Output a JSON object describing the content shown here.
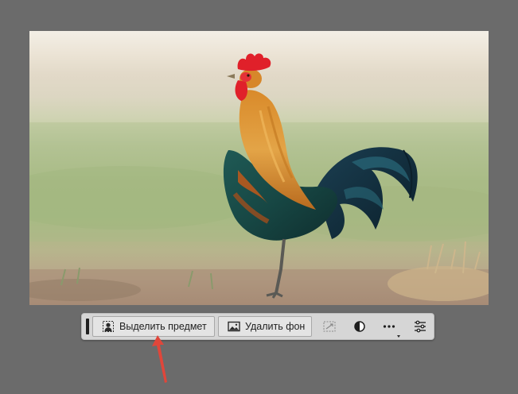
{
  "canvas": {
    "image_subject": "rooster-photo"
  },
  "taskbar": {
    "select_subject_label": "Выделить предмет",
    "remove_background_label": "Удалить фон",
    "icons": {
      "select_subject": "person-silhouette-icon",
      "remove_background": "image-icon",
      "transform_selection": "transform-selection-icon",
      "adjustment": "half-circle-adjustment-icon",
      "more": "ellipsis-icon",
      "properties": "sliders-icon"
    }
  },
  "colors": {
    "app_background": "#6b6b6b",
    "taskbar_background": "#d6d6d6",
    "annotation_arrow": "#e0463a"
  }
}
